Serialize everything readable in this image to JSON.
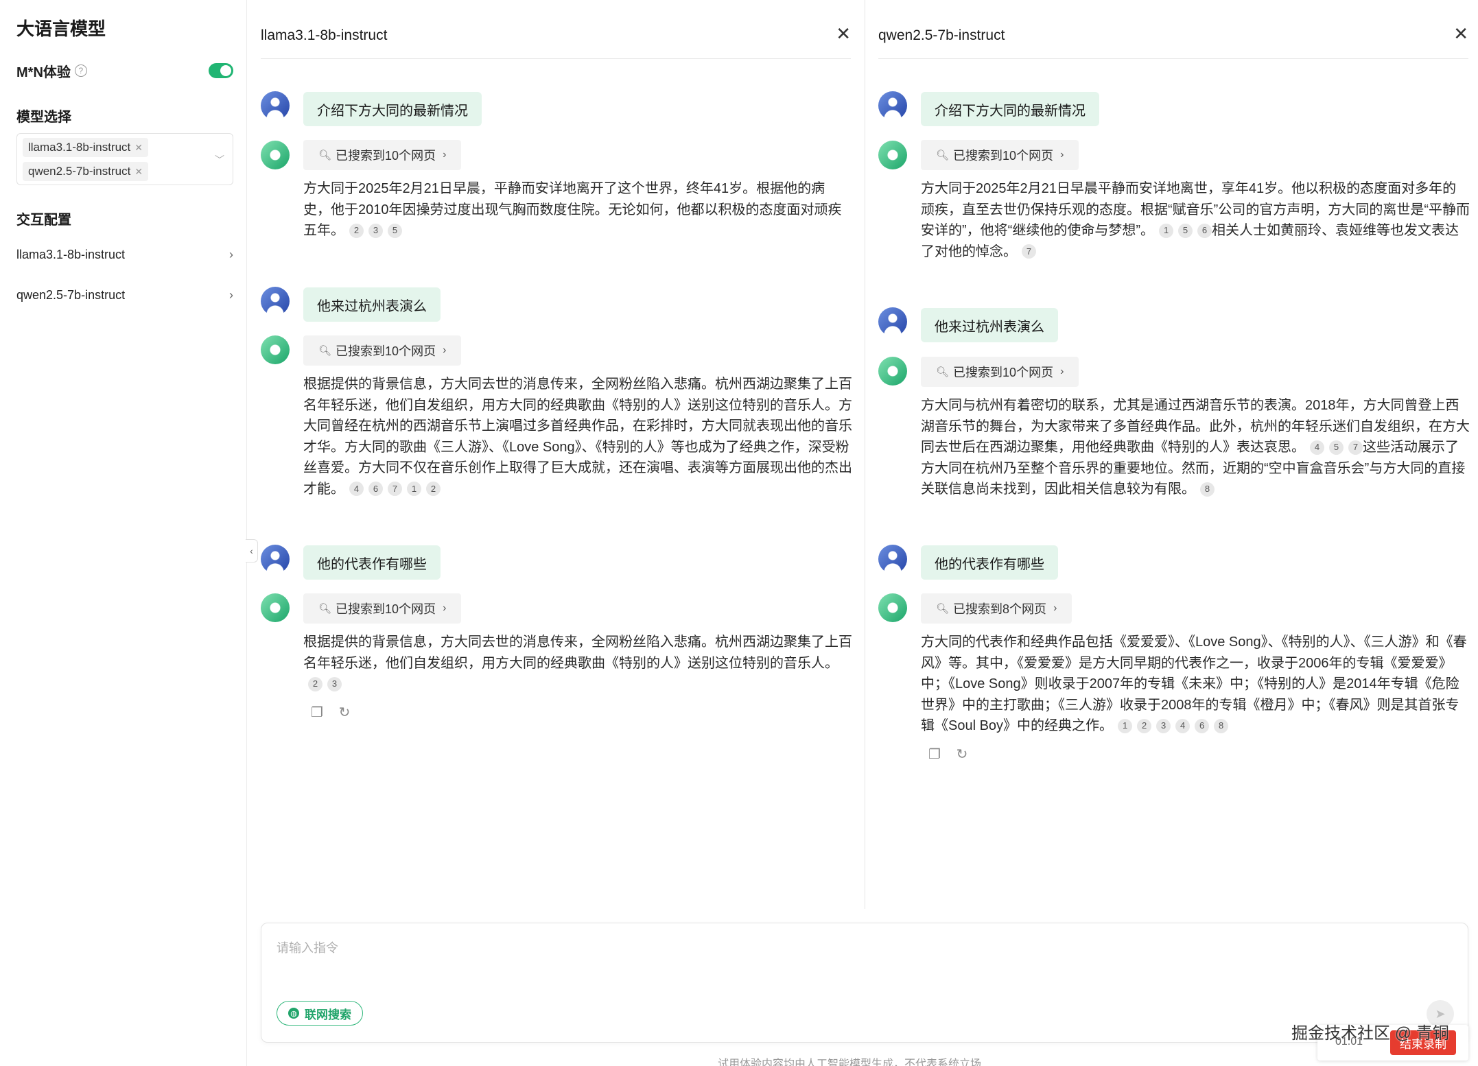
{
  "sidebar": {
    "title": "大语言模型",
    "mn_label": "M*N体验",
    "help_icon": "help-circle-icon",
    "toggle_on": true,
    "model_section": "模型选择",
    "selected_models": [
      "llama3.1-8b-instruct",
      "qwen2.5-7b-instruct"
    ],
    "config_section": "交互配置",
    "config_items": [
      "llama3.1-8b-instruct",
      "qwen2.5-7b-instruct"
    ]
  },
  "left": {
    "title": "llama3.1-8b-instruct",
    "turns": [
      {
        "question": "介绍下方大同的最新情况",
        "search": "已搜索到10个网页",
        "answer": "方大同于2025年2月21日早晨，平静而安详地离开了这个世界，终年41岁。根据他的病史，他于2010年因操劳过度出现气胸而数度住院。无论如何，他都以积极的态度面对顽疾五年。",
        "cites": [
          "2",
          "3",
          "5"
        ]
      },
      {
        "question": "他来过杭州表演么",
        "search": "已搜索到10个网页",
        "answer": "根据提供的背景信息，方大同去世的消息传来，全网粉丝陷入悲痛。杭州西湖边聚集了上百名年轻乐迷，他们自发组织，用方大同的经典歌曲《特别的人》送别这位特别的音乐人。方大同曾经在杭州的西湖音乐节上演唱过多首经典作品，在彩排时，方大同就表现出他的音乐才华。方大同的歌曲《三人游》、《Love Song》、《特别的人》等也成为了经典之作，深受粉丝喜爱。方大同不仅在音乐创作上取得了巨大成就，还在演唱、表演等方面展现出他的杰出才能。",
        "cites": [
          "4",
          "6",
          "7",
          "1",
          "2"
        ]
      },
      {
        "question": "他的代表作有哪些",
        "search": "已搜索到10个网页",
        "answer": "根据提供的背景信息，方大同去世的消息传来，全网粉丝陷入悲痛。杭州西湖边聚集了上百名年轻乐迷，他们自发组织，用方大同的经典歌曲《特别的人》送别这位特别的音乐人。",
        "cites": [
          "2",
          "3"
        ]
      }
    ]
  },
  "right": {
    "title": "qwen2.5-7b-instruct",
    "turns": [
      {
        "question": "介绍下方大同的最新情况",
        "search": "已搜索到10个网页",
        "answer_a": "方大同于2025年2月21日早晨平静而安详地离世，享年41岁。他以积极的态度面对多年的顽疾，直至去世仍保持乐观的态度。根据“赋音乐”公司的官方声明，方大同的离世是“平静而安详的”，他将“继续他的使命与梦想”。",
        "cites_a": [
          "1",
          "5",
          "6"
        ],
        "answer_b": "相关人士如黄丽玲、袁娅维等也发文表达了对他的悼念。",
        "cites_b": [
          "7"
        ]
      },
      {
        "question": "他来过杭州表演么",
        "search": "已搜索到10个网页",
        "answer_a": "方大同与杭州有着密切的联系，尤其是通过西湖音乐节的表演。2018年，方大同曾登上西湖音乐节的舞台，为大家带来了多首经典作品。此外，杭州的年轻乐迷们自发组织，在方大同去世后在西湖边聚集，用他经典歌曲《特别的人》表达哀思。",
        "cites_a": [
          "4",
          "5",
          "7"
        ],
        "answer_b": "这些活动展示了方大同在杭州乃至整个音乐界的重要地位。然而，近期的“空中盲盒音乐会”与方大同的直接关联信息尚未找到，因此相关信息较为有限。",
        "cites_b": [
          "8"
        ]
      },
      {
        "question": "他的代表作有哪些",
        "search": "已搜索到8个网页",
        "answer_a": "方大同的代表作和经典作品包括《爱爱爱》、《Love Song》、《特别的人》、《三人游》和《春风》等。其中，《爱爱爱》是方大同早期的代表作之一，收录于2006年的专辑《爱爱爱》中；《Love Song》则收录于2007年的专辑《未来》中；《特别的人》是2014年专辑《危险世界》中的主打歌曲；《三人游》收录于2008年的专辑《橙月》中；《春风》则是其首张专辑《Soul Boy》中的经典之作。",
        "cites_a": [
          "1",
          "2",
          "3",
          "4",
          "6",
          "8"
        ]
      }
    ]
  },
  "input": {
    "placeholder": "请输入指令",
    "net_search": "联网搜索",
    "footer": "试用体验内容均由人工智能模型生成，不代表系统立场"
  },
  "overlay": {
    "watermark": "掘金技术社区 @ 青铜",
    "rec_time": "01:01",
    "rec_button": "结束录制"
  },
  "colors": {
    "accent": "#21b573",
    "question_bg": "#e4f5ec",
    "stop": "#e63c2f"
  }
}
